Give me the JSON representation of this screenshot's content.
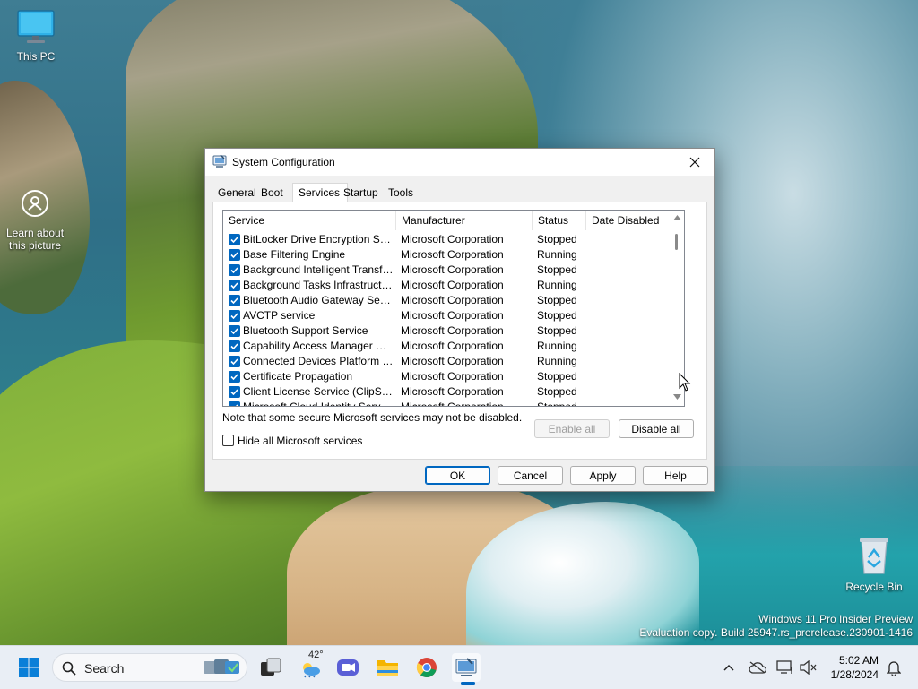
{
  "desktop": {
    "icons": [
      {
        "label": "This PC",
        "icon": "monitor-icon"
      },
      {
        "label": "Learn about\nthis picture",
        "label_line1": "Learn about",
        "label_line2": "this picture",
        "icon": "camera-icon"
      },
      {
        "label": "Recycle Bin",
        "icon": "recycle-bin-icon"
      }
    ],
    "watermark": {
      "line1": "Windows 11 Pro Insider Preview",
      "line2": "Evaluation copy. Build 25947.rs_prerelease.230901-1416"
    }
  },
  "dialog": {
    "title": "System Configuration",
    "tabs": [
      "General",
      "Boot",
      "Services",
      "Startup",
      "Tools"
    ],
    "active_tab": "Services",
    "columns": [
      "Service",
      "Manufacturer",
      "Status",
      "Date Disabled"
    ],
    "rows": [
      {
        "service": "BitLocker Drive Encryption Service",
        "manufacturer": "Microsoft Corporation",
        "status": "Stopped",
        "date_disabled": "",
        "checked": true
      },
      {
        "service": "Base Filtering Engine",
        "manufacturer": "Microsoft Corporation",
        "status": "Running",
        "date_disabled": "",
        "checked": true
      },
      {
        "service": "Background Intelligent Transfer ...",
        "manufacturer": "Microsoft Corporation",
        "status": "Stopped",
        "date_disabled": "",
        "checked": true
      },
      {
        "service": "Background Tasks Infrastructur...",
        "manufacturer": "Microsoft Corporation",
        "status": "Running",
        "date_disabled": "",
        "checked": true
      },
      {
        "service": "Bluetooth Audio Gateway Service",
        "manufacturer": "Microsoft Corporation",
        "status": "Stopped",
        "date_disabled": "",
        "checked": true
      },
      {
        "service": "AVCTP service",
        "manufacturer": "Microsoft Corporation",
        "status": "Stopped",
        "date_disabled": "",
        "checked": true
      },
      {
        "service": "Bluetooth Support Service",
        "manufacturer": "Microsoft Corporation",
        "status": "Stopped",
        "date_disabled": "",
        "checked": true
      },
      {
        "service": "Capability Access Manager Service",
        "manufacturer": "Microsoft Corporation",
        "status": "Running",
        "date_disabled": "",
        "checked": true
      },
      {
        "service": "Connected Devices Platform Ser...",
        "manufacturer": "Microsoft Corporation",
        "status": "Running",
        "date_disabled": "",
        "checked": true
      },
      {
        "service": "Certificate Propagation",
        "manufacturer": "Microsoft Corporation",
        "status": "Stopped",
        "date_disabled": "",
        "checked": true
      },
      {
        "service": "Client License Service (ClipSVC)",
        "manufacturer": "Microsoft Corporation",
        "status": "Stopped",
        "date_disabled": "",
        "checked": true
      },
      {
        "service": "Microsoft Cloud Identity Service",
        "manufacturer": "Microsoft Corporation",
        "status": "Stopped",
        "date_disabled": "",
        "checked": true
      }
    ],
    "note": "Note that some secure Microsoft services may not be disabled.",
    "enable_all": "Enable all",
    "disable_all": "Disable all",
    "hide_ms_label": "Hide all Microsoft services",
    "hide_ms_checked": false,
    "buttons": {
      "ok": "OK",
      "cancel": "Cancel",
      "apply": "Apply",
      "help": "Help"
    }
  },
  "taskbar": {
    "search_placeholder": "Search",
    "weather_temp": "42°",
    "pinned": [
      "task-view-icon",
      "weather-icon",
      "meet-icon",
      "file-explorer-icon",
      "chrome-icon",
      "system-configuration-icon"
    ],
    "clock": {
      "time": "5:02 AM",
      "date": "1/28/2024"
    }
  },
  "colors": {
    "accent": "#0067c0",
    "taskbar": "#e9eef5",
    "dialog_bg": "#f0f0f0"
  }
}
